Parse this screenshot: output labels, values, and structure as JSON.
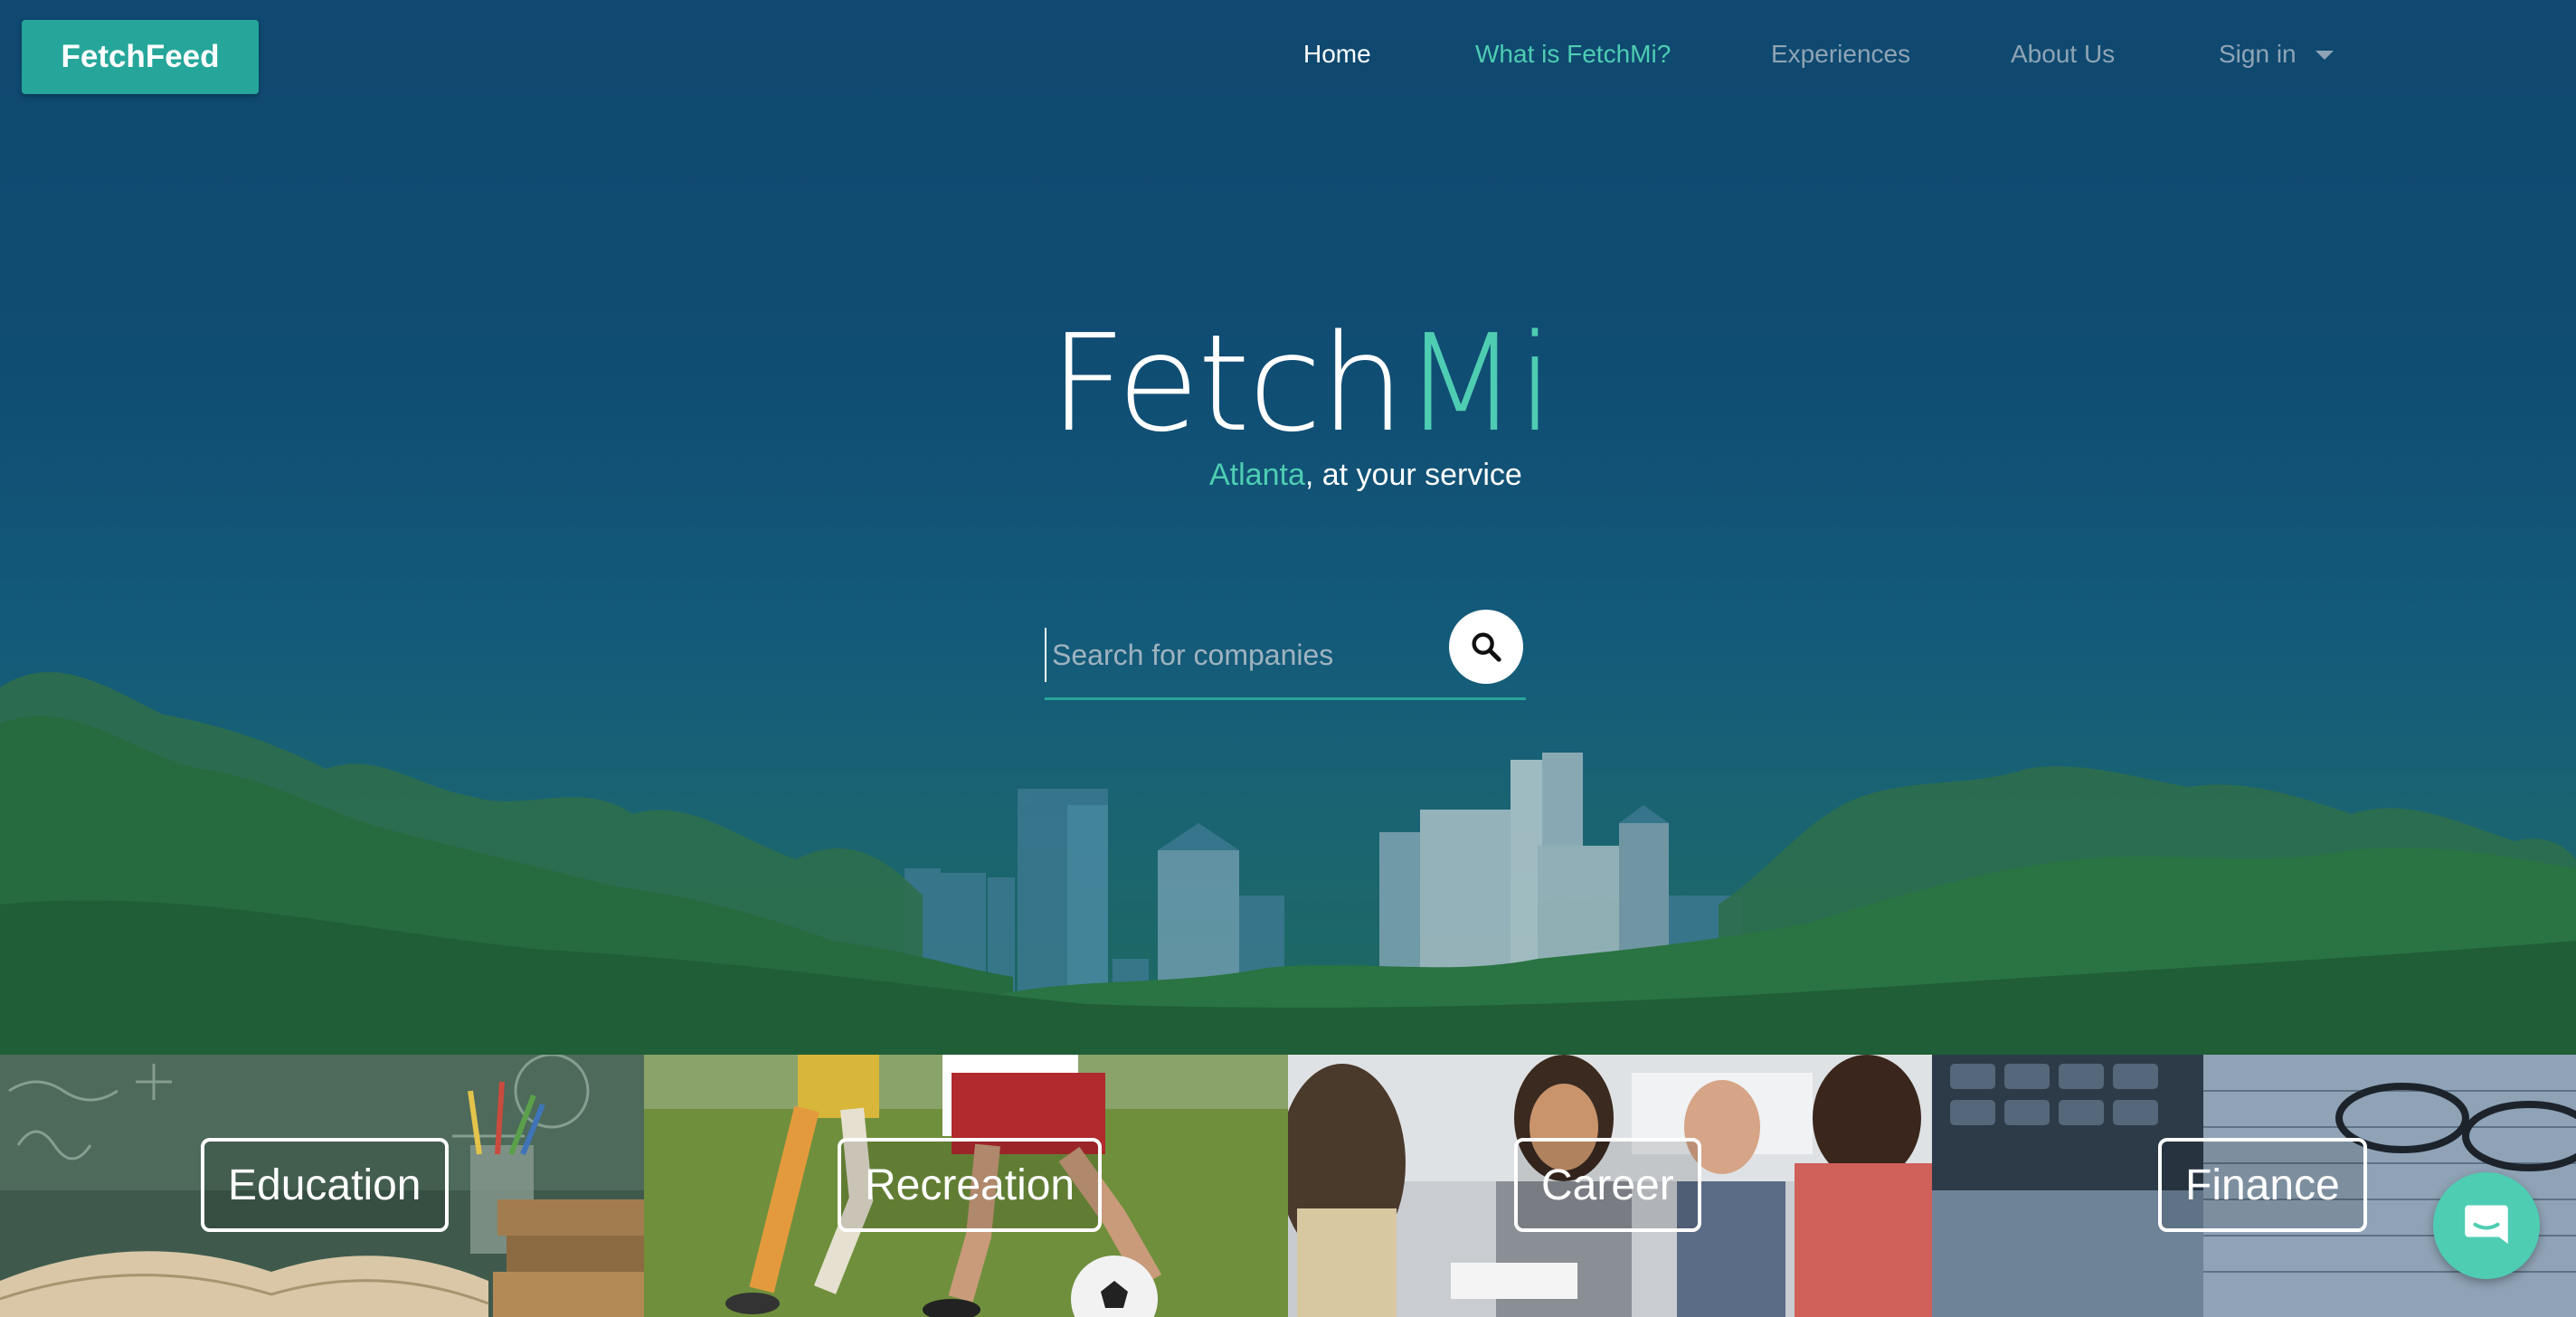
{
  "brand": {
    "label": "FetchFeed"
  },
  "nav": {
    "items": [
      {
        "label": "Home"
      },
      {
        "label": "What is FetchMi?"
      },
      {
        "label": "Experiences"
      },
      {
        "label": "About Us"
      },
      {
        "label": "Sign in"
      }
    ]
  },
  "hero": {
    "title_part1": "Fetch",
    "title_part2": "Mi",
    "subtitle_city": "Atlanta",
    "subtitle_rest": ", at your service"
  },
  "search": {
    "placeholder": "Search for companies",
    "value": ""
  },
  "categories": [
    {
      "label": "Education"
    },
    {
      "label": "Recreation"
    },
    {
      "label": "Career"
    },
    {
      "label": "Finance"
    }
  ],
  "icons": {
    "search": "search-icon",
    "dropdown": "chevron-down-icon",
    "chat": "chat-icon"
  },
  "colors": {
    "accent": "#26a69a",
    "accent_light": "#4ecdb2",
    "hero_bg": "#0f4a6e",
    "nav_inactive": "#8fa4b4"
  }
}
